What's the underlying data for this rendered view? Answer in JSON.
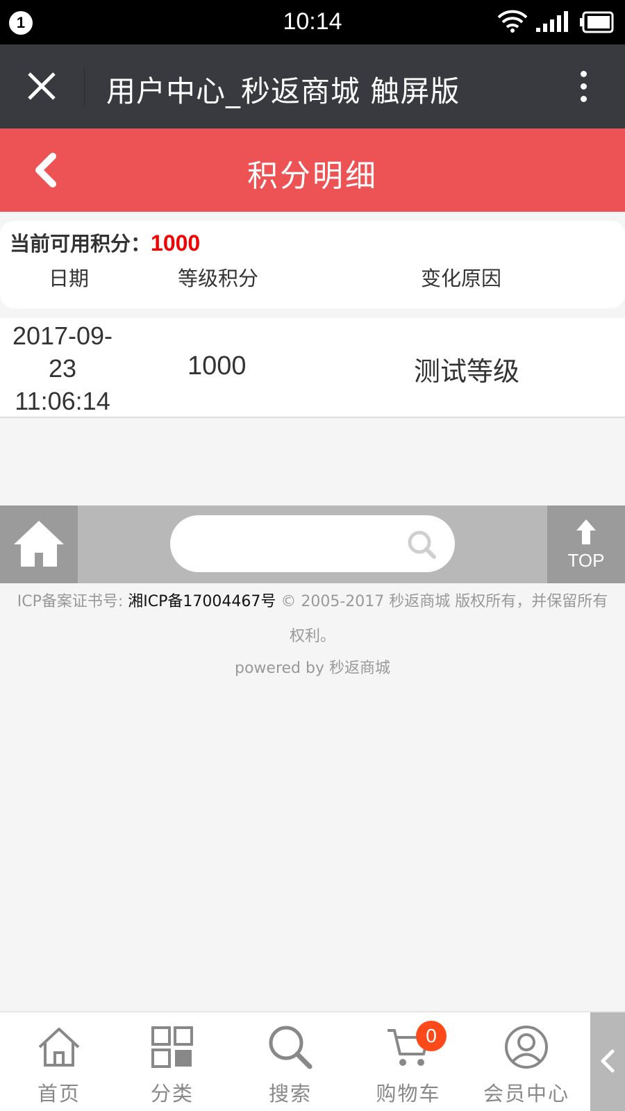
{
  "status_bar": {
    "notification_count": "1",
    "time": "10:14"
  },
  "app_bar": {
    "title": "用户中心_秒返商城 触屏版",
    "close_icon": "close-icon",
    "more_icon": "more-vertical-icon"
  },
  "header": {
    "title": "积分明细",
    "back_icon": "chevron-left-icon"
  },
  "points": {
    "label": "当前可用积分：",
    "value": "1000"
  },
  "table": {
    "columns": [
      "日期",
      "等级积分",
      "变化原因"
    ],
    "rows": [
      {
        "date_line1": "2017-09-",
        "date_line2": "23",
        "date_line3": "11:06:14",
        "points": "1000",
        "reason": "测试等级"
      }
    ]
  },
  "footer_bar": {
    "search_placeholder": "",
    "top_label": "TOP"
  },
  "copyright": {
    "icp_prefix": "ICP备案证书号: ",
    "icp_number": "湘ICP备17004467号",
    "rights": " © 2005-2017 秒返商城 版权所有，并保留所有权利。",
    "powered": "powered by 秒返商城"
  },
  "bottom_nav": {
    "items": [
      {
        "label": "首页",
        "icon": "home-icon"
      },
      {
        "label": "分类",
        "icon": "category-grid-icon"
      },
      {
        "label": "搜索",
        "icon": "search-icon"
      },
      {
        "label": "购物车",
        "icon": "cart-icon"
      },
      {
        "label": "会员中心",
        "icon": "user-icon"
      }
    ],
    "cart_count": "0"
  },
  "colors": {
    "header_red": "#ed5354",
    "points_red": "#f00000",
    "app_bar": "#393a3f",
    "cart_badge": "#fe4a1a"
  }
}
